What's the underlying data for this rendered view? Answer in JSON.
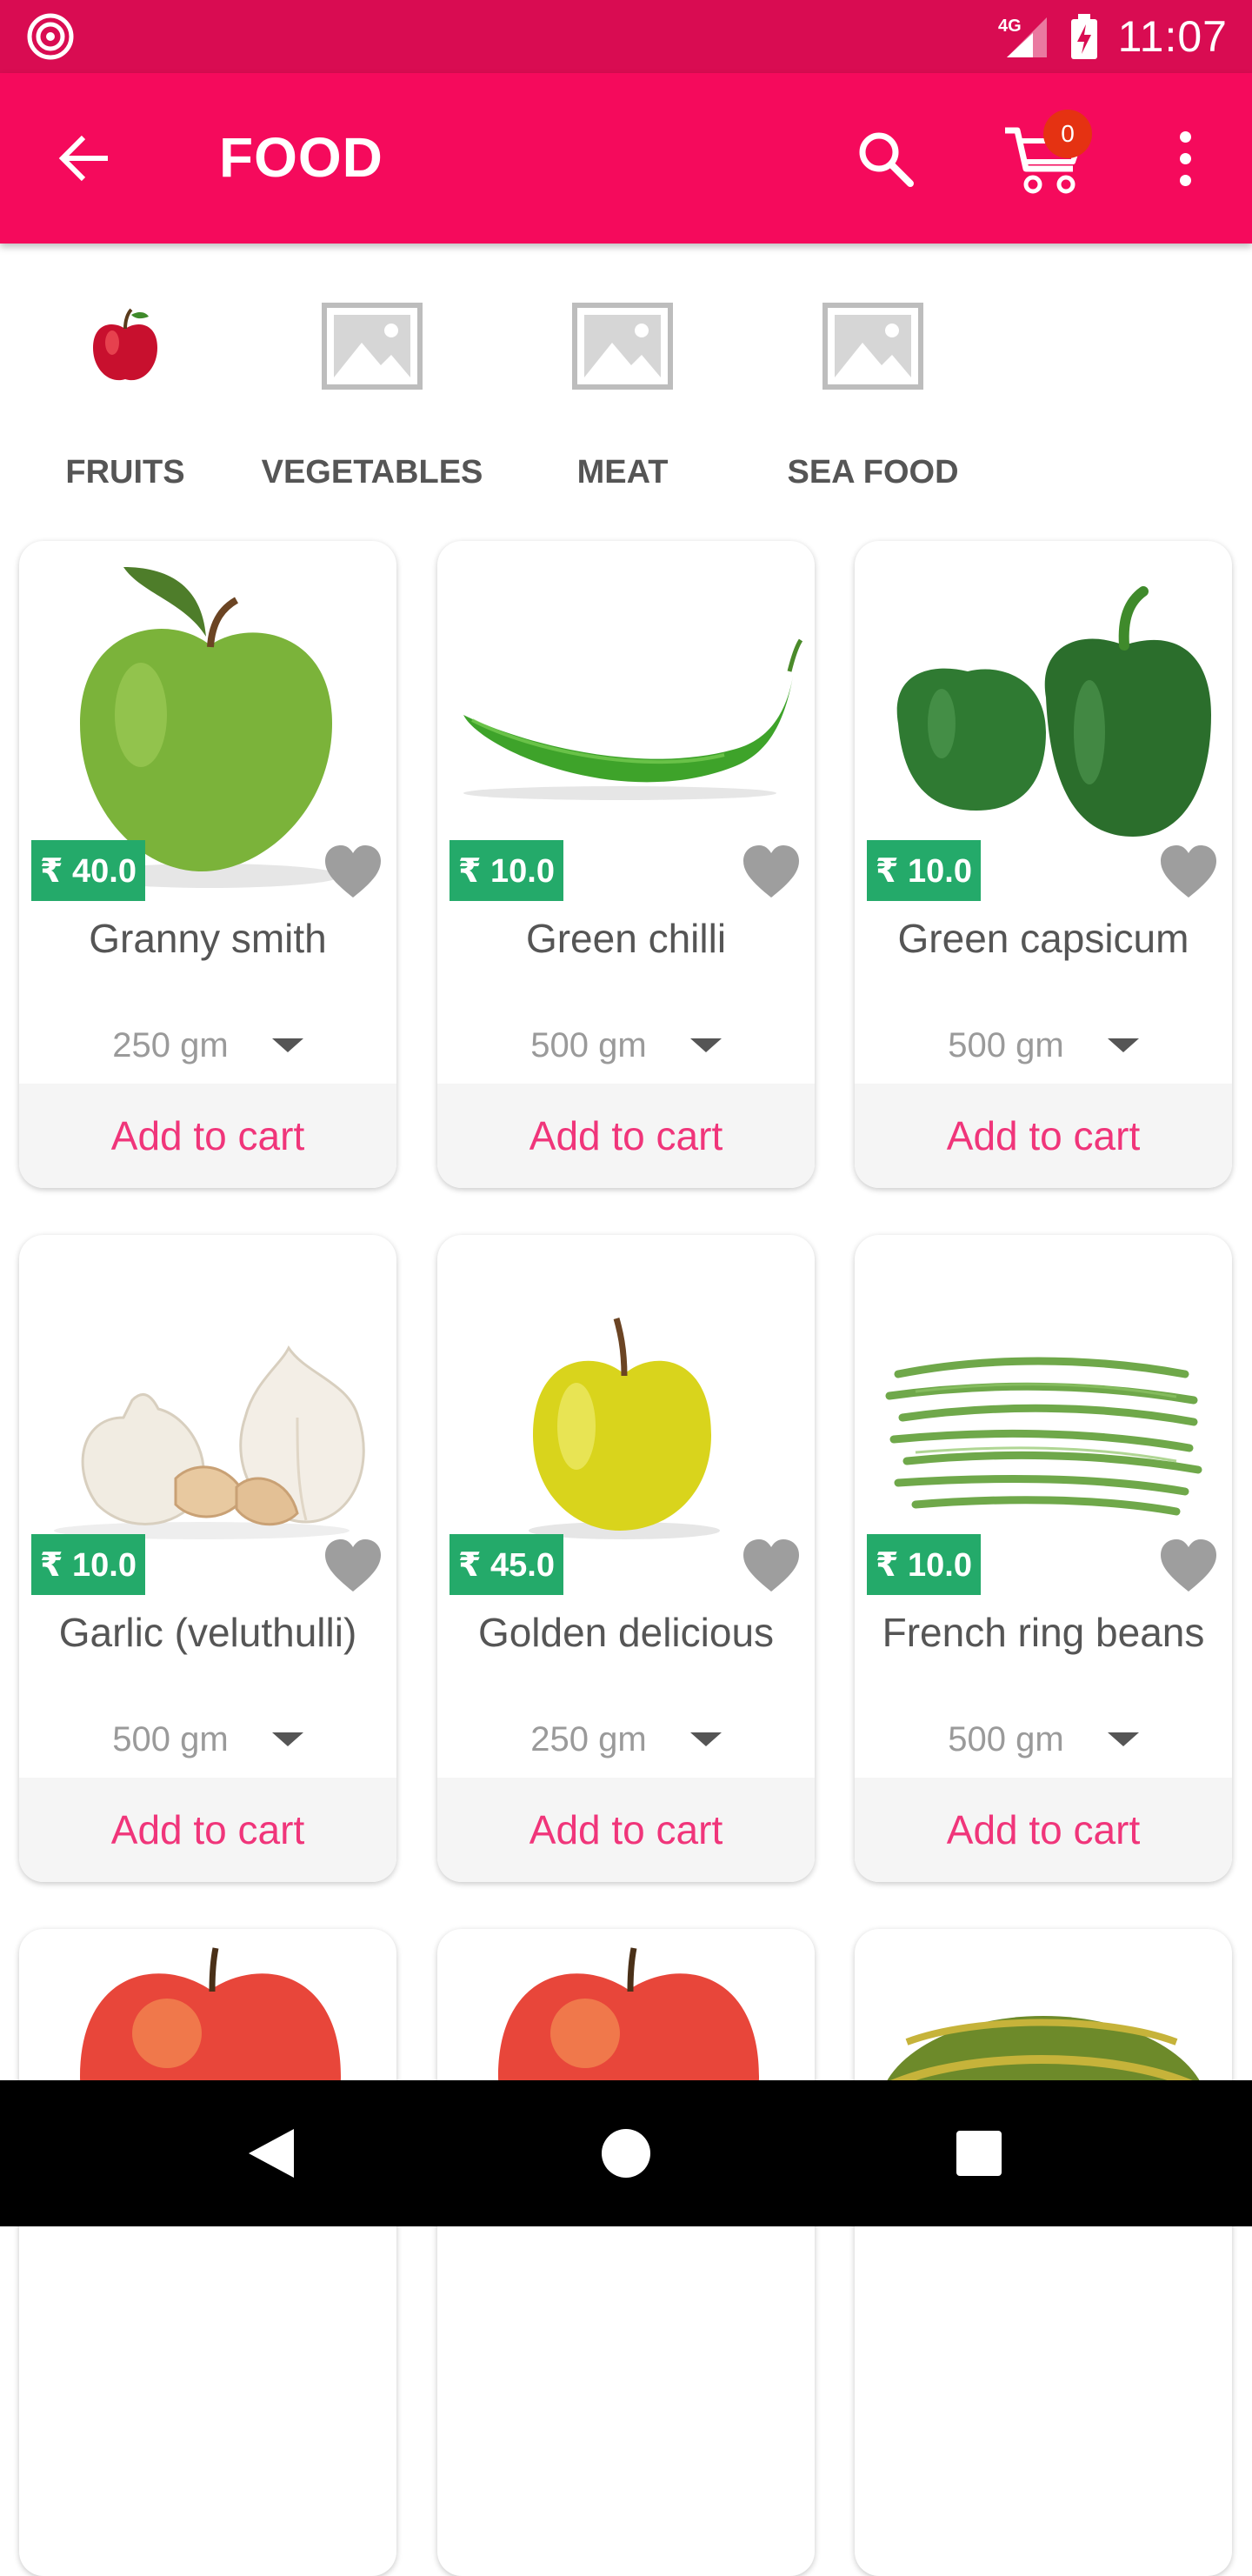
{
  "status_bar": {
    "time": "11:07",
    "network": "4G"
  },
  "app_bar": {
    "title": "FOOD",
    "cart_count": "0",
    "accent": "#f50a5c"
  },
  "categories": [
    {
      "label": "FRUITS",
      "icon": "apple-icon"
    },
    {
      "label": "VEGETABLES",
      "icon": "image-placeholder-icon"
    },
    {
      "label": "MEAT",
      "icon": "image-placeholder-icon"
    },
    {
      "label": "SEA FOOD",
      "icon": "image-placeholder-icon"
    }
  ],
  "products": [
    {
      "name": "Granny smith",
      "price": "₹ 40.0",
      "qty": "250 gm",
      "add": "Add to cart",
      "image": "green-apple"
    },
    {
      "name": "Green chilli",
      "price": "₹ 10.0",
      "qty": "500 gm",
      "add": "Add to cart",
      "image": "green-chilli"
    },
    {
      "name": "Green capsicum",
      "price": "₹ 10.0",
      "qty": "500 gm",
      "add": "Add to cart",
      "image": "green-capsicum"
    },
    {
      "name": "Garlic (veluthulli)",
      "price": "₹ 10.0",
      "qty": "500 gm",
      "add": "Add to cart",
      "image": "garlic"
    },
    {
      "name": "Golden delicious",
      "price": "₹ 45.0",
      "qty": "250 gm",
      "add": "Add to cart",
      "image": "yellow-apple"
    },
    {
      "name": "French ring beans",
      "price": "₹ 10.0",
      "qty": "500 gm",
      "add": "Add to cart",
      "image": "green-beans"
    }
  ],
  "colors": {
    "price_badge": "#24aa6a",
    "add_to_cart_text": "#f0357a",
    "status_bar": "#d90c52"
  }
}
